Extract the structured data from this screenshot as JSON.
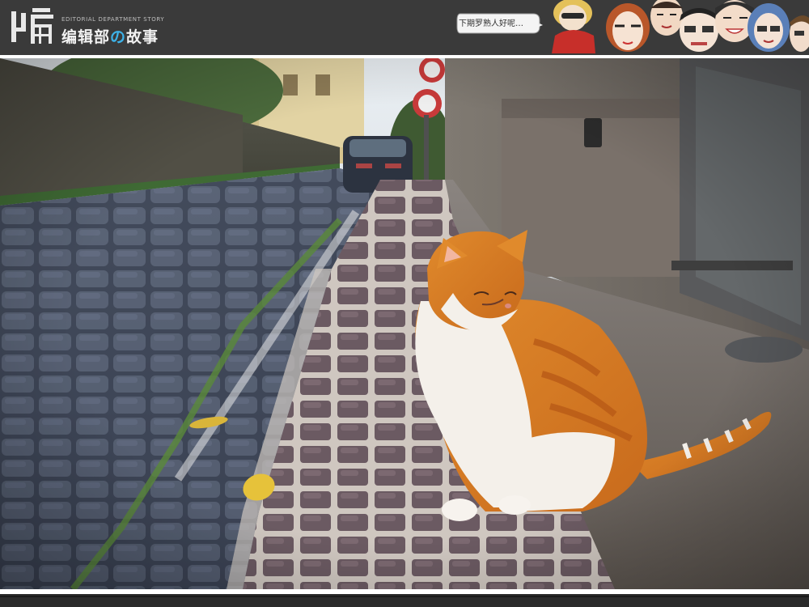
{
  "header": {
    "logo_sub": "EDITORIAL DEPARTMENT STORY",
    "title_part1": "编辑部",
    "title_no": "の",
    "title_part2": "故事",
    "bubble_text": "下期罗熟人好呢…",
    "accent_color": "#3db2e8"
  },
  "photo": {
    "subject": "orange-and-white cat sitting on cobblestone street",
    "leaf_color": "#e6c23a"
  }
}
